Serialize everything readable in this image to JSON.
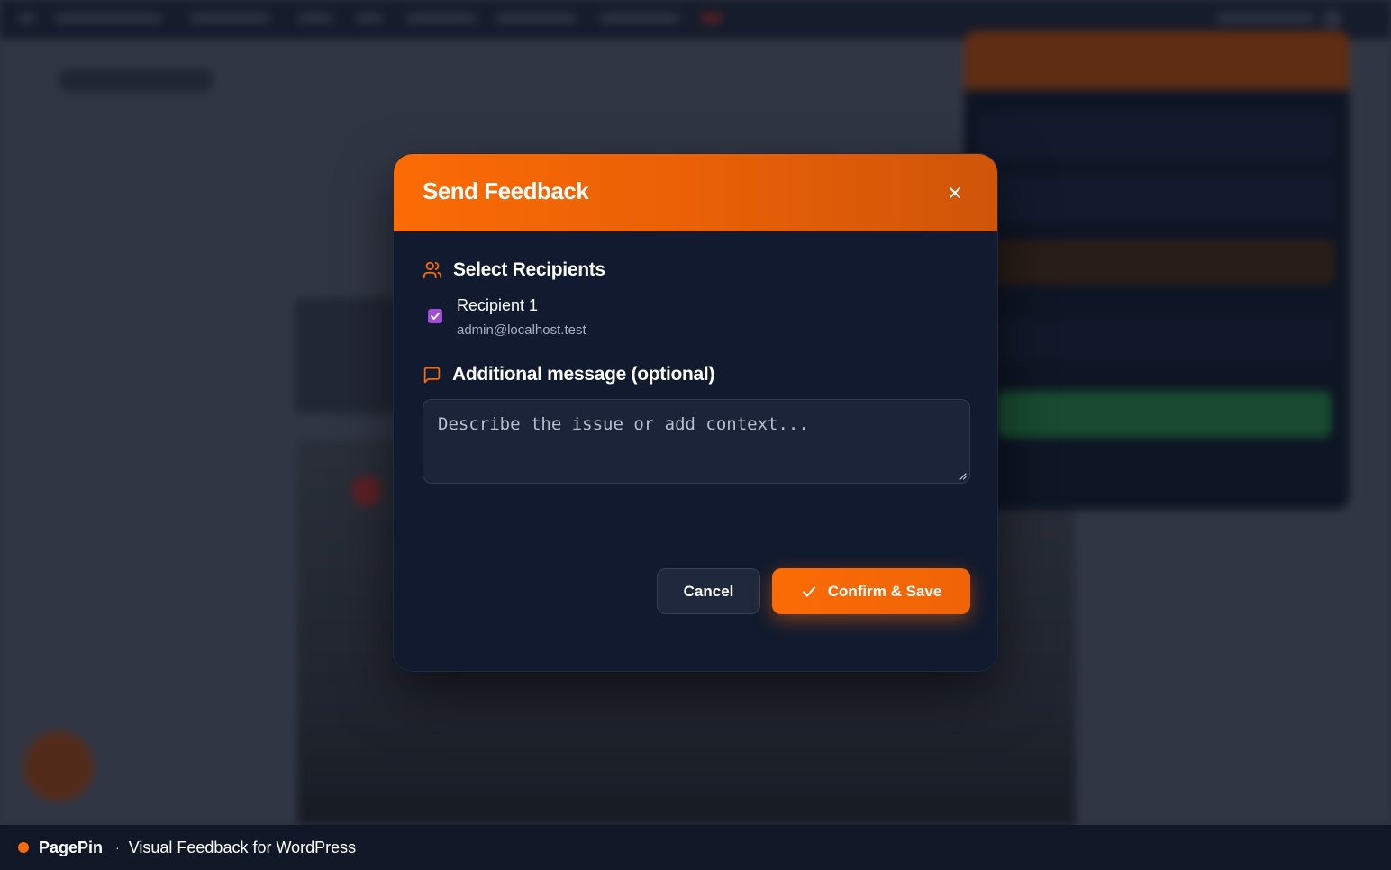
{
  "modal": {
    "title": "Send Feedback",
    "close_icon": "close-icon",
    "recipients_section": {
      "title": "Select Recipients",
      "icon": "users-icon",
      "recipients": [
        {
          "name": "Recipient 1",
          "email": "admin@localhost.test",
          "checked": true
        }
      ]
    },
    "message_section": {
      "title": "Additional message (optional)",
      "icon": "message-icon",
      "placeholder": "Describe the issue or add context...",
      "value": ""
    },
    "actions": {
      "cancel_label": "Cancel",
      "confirm_label": "Confirm & Save",
      "confirm_icon": "check-icon"
    }
  },
  "footer": {
    "brand": "PagePin",
    "separator": "·",
    "tagline": "Visual Feedback for WordPress"
  },
  "colors": {
    "accent": "#fb6b05",
    "modal_bg": "#111a2e",
    "checkbox": "#a24bd6",
    "footer_bg": "#101828"
  }
}
